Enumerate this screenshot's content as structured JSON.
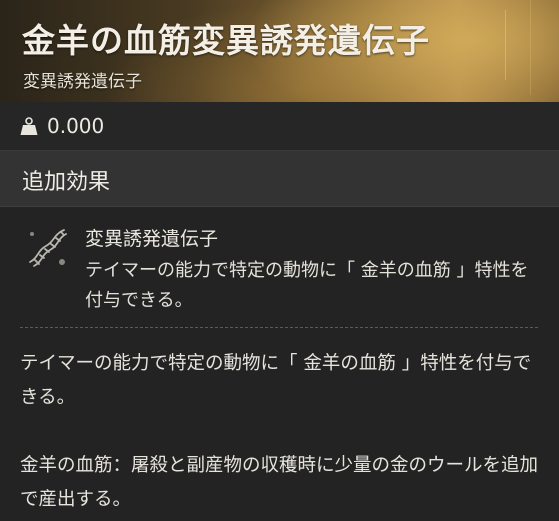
{
  "item": {
    "title": "金羊の血筋変異誘発遺伝子",
    "subtitle": "変異誘発遺伝子",
    "weight": "0.000",
    "weight_icon": "weight-icon"
  },
  "section": {
    "heading": "追加効果"
  },
  "effect": {
    "icon": "dna-helix-icon",
    "name": "変異誘発遺伝子",
    "description": "テイマーの能力で特定の動物に「 金羊の血筋 」特性を付与できる。"
  },
  "details": {
    "main": "テイマーの能力で特定の動物に「 金羊の血筋 」特性を付与できる。",
    "trait_detail": "金羊の血筋：屠殺と副産物の収穫時に少量の金のウールを追加で産出する。"
  },
  "colors": {
    "header_gold": "#b3894a",
    "panel_bg": "#232323",
    "section_bg": "#333333",
    "text": "#e6e3dc"
  }
}
